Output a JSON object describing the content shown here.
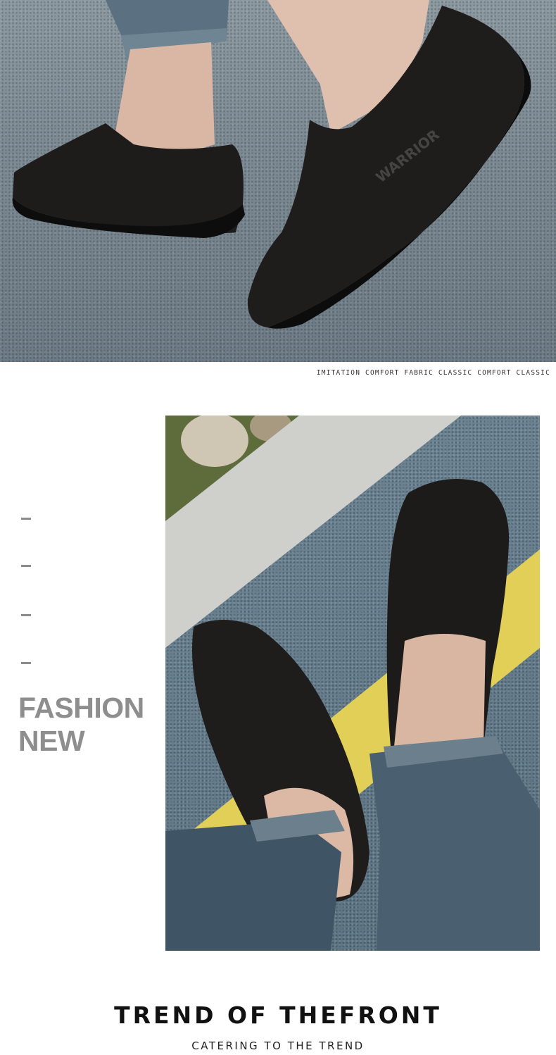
{
  "top_banner": {
    "image_label": "black-slip-on-shoes-walking-photo",
    "shoe_brand_text": "WARRIOR",
    "tagline": "IMITATION COMFORT FABRIC CLASSIC COMFORT CLASSIC"
  },
  "side": {
    "dashes": [
      "-",
      "-",
      "-",
      "-"
    ],
    "heading_line1": "FASHION",
    "heading_line2": "NEW"
  },
  "second_banner": {
    "image_label": "top-view-black-slip-on-shoes-on-road-photo"
  },
  "footer": {
    "title": "TREND OF THEFRONT",
    "subtitle": "CATERING TO THE TREND"
  },
  "colors": {
    "heading_gray": "#8e8e8e",
    "title_black": "#111111",
    "shoe_black": "#1c1a19",
    "road_yellow": "#e8d35a"
  }
}
